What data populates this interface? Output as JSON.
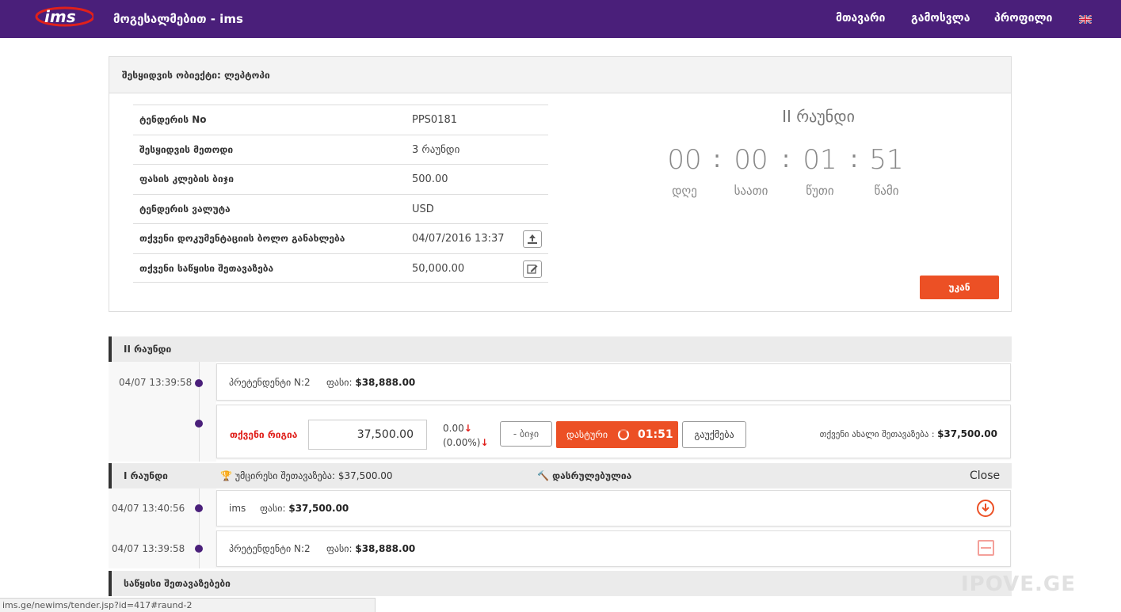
{
  "nav": {
    "logo_text": "ims",
    "title": "მოგესალმებით - ims",
    "links": [
      "მთავარი",
      "გამოსვლა",
      "პროფილი"
    ],
    "brand_color": "#4a1f7a"
  },
  "panel": {
    "title": "შესყიდვის ობიექტი: ლეპტოპი",
    "rows": [
      {
        "label": "ტენდერის No",
        "value": "PPS0181"
      },
      {
        "label": "შესყიდვის მეთოდი",
        "value": "3 რაუნდი"
      },
      {
        "label": "ფასის კლების ბიჯი",
        "value": "500.00"
      },
      {
        "label": "ტენდერის ვალუტა",
        "value": "USD"
      },
      {
        "label": "თქვენი დოკუმენტაციის ბოლო განახლება",
        "value": "04/07/2016 13:37"
      },
      {
        "label": "თქვენი საწყისი შეთავაზება",
        "value": "50,000.00"
      }
    ],
    "round_title": "II რაუნდი",
    "timer": {
      "days": "00",
      "hours": "00",
      "minutes": "01",
      "seconds": "51",
      "days_label": "დღე",
      "hours_label": "საათი",
      "minutes_label": "წუთი",
      "seconds_label": "წამი"
    },
    "back_label": "უკან",
    "accent_color": "#ec5025"
  },
  "round2": {
    "title": "II რაუნდი",
    "entry": {
      "time": "04/07 13:39:58",
      "participant": "პრეტენდენტი N:2",
      "price_label": "ფასი:",
      "price": "$38,888.00"
    },
    "bid": {
      "queue_label": "თქვენი რიგია",
      "input_value": "37,500.00",
      "delta_value": "0.00",
      "delta_percent": "(0.00%)",
      "step_label": "- ბიჯი",
      "confirm_label": "დასტური",
      "confirm_time": "01:51",
      "cancel_label": "გაუქმება",
      "new_offer_label": "თქვენი ახალი შეთავაზება :",
      "new_offer_value": "$37,500.00"
    }
  },
  "round1": {
    "title": "I რაუნდი",
    "lowest_label": "უმცირესი შეთავაზება:",
    "lowest_value": "$37,500.00",
    "status": "დასრულებულია",
    "close_label": "Close",
    "entries": [
      {
        "time": "04/07 13:40:56",
        "participant": "ims",
        "price_label": "ფასი:",
        "price": "$37,500.00"
      },
      {
        "time": "04/07 13:39:58",
        "participant": "პრეტენდენტი N:2",
        "price_label": "ფასი:",
        "price": "$38,888.00"
      }
    ]
  },
  "initial": {
    "title": "საწყისი შეთავაზებები"
  },
  "statusbar": {
    "url": "ims.ge/newims/tender.jsp?id=417#raund-2"
  },
  "watermark": "IPOVE.GE"
}
